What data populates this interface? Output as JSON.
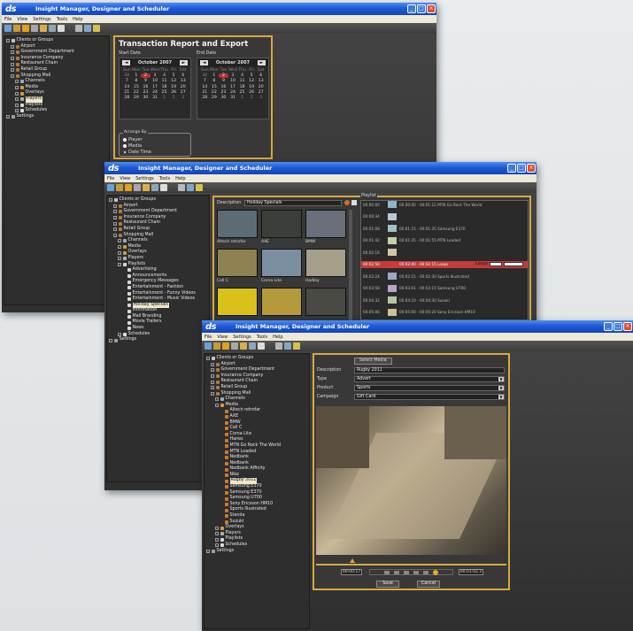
{
  "app_title": "Insight Manager, Designer and Scheduler",
  "logo_text": "ds",
  "menu": [
    "File",
    "View",
    "Settings",
    "Tools",
    "Help"
  ],
  "window_controls": {
    "min": "_",
    "max": "□",
    "close": "×"
  },
  "win1": {
    "tree": [
      {
        "label": "Clients or Groups",
        "indent": 0,
        "icon": "group"
      },
      {
        "label": "Airport",
        "indent": 1,
        "icon": "client"
      },
      {
        "label": "Government Department",
        "indent": 1,
        "icon": "client"
      },
      {
        "label": "Insurance Company",
        "indent": 1,
        "icon": "client"
      },
      {
        "label": "Restaurant Chain",
        "indent": 1,
        "icon": "client"
      },
      {
        "label": "Retail Group",
        "indent": 1,
        "icon": "client"
      },
      {
        "label": "Shopping Mall",
        "indent": 1,
        "icon": "client"
      },
      {
        "label": "Channels",
        "indent": 2,
        "icon": "channel"
      },
      {
        "label": "Media",
        "indent": 2,
        "icon": "media"
      },
      {
        "label": "Overlays",
        "indent": 2,
        "icon": "overlay"
      },
      {
        "label": "Players",
        "indent": 2,
        "icon": "player",
        "selected": true
      },
      {
        "label": "Playlists",
        "indent": 2,
        "icon": "playlist"
      },
      {
        "label": "Schedules",
        "indent": 2,
        "icon": "schedule"
      },
      {
        "label": "Settings",
        "indent": 0,
        "icon": "settings"
      }
    ],
    "panel_title": "Transaction Report and Export",
    "start_label": "Start Date",
    "end_label": "End Date",
    "start_month": "October 2007",
    "end_month": "October 2007",
    "weekdays": [
      "Sun",
      "Mon",
      "Tue",
      "Wed",
      "Thu",
      "Fri",
      "Sat"
    ],
    "start_days": [
      "30",
      "1",
      "2",
      "3",
      "4",
      "5",
      "6",
      "7",
      "8",
      "9",
      "10",
      "11",
      "12",
      "13",
      "14",
      "15",
      "16",
      "17",
      "18",
      "19",
      "20",
      "21",
      "22",
      "23",
      "24",
      "25",
      "26",
      "27",
      "28",
      "29",
      "30",
      "31",
      "1",
      "2",
      "3"
    ],
    "end_days": [
      "30",
      "1",
      "2",
      "3",
      "4",
      "5",
      "6",
      "7",
      "8",
      "9",
      "10",
      "11",
      "12",
      "13",
      "14",
      "15",
      "16",
      "17",
      "18",
      "19",
      "20",
      "21",
      "22",
      "23",
      "24",
      "25",
      "26",
      "27",
      "28",
      "29",
      "30",
      "31",
      "1",
      "2",
      "3"
    ],
    "arrange_label": "Arrange By",
    "arrange_options": [
      "Player",
      "Media",
      "Date Time"
    ]
  },
  "win2": {
    "tree": [
      {
        "label": "Clients or Groups",
        "indent": 0,
        "icon": "group"
      },
      {
        "label": "Airport",
        "indent": 1,
        "icon": "client"
      },
      {
        "label": "Government Department",
        "indent": 1,
        "icon": "client"
      },
      {
        "label": "Insurance Company",
        "indent": 1,
        "icon": "client"
      },
      {
        "label": "Restaurant Chain",
        "indent": 1,
        "icon": "client"
      },
      {
        "label": "Retail Group",
        "indent": 1,
        "icon": "client"
      },
      {
        "label": "Shopping Mall",
        "indent": 1,
        "icon": "client"
      },
      {
        "label": "Channels",
        "indent": 2,
        "icon": "channel"
      },
      {
        "label": "Media",
        "indent": 2,
        "icon": "media"
      },
      {
        "label": "Overlays",
        "indent": 2,
        "icon": "overlay"
      },
      {
        "label": "Players",
        "indent": 2,
        "icon": "player"
      },
      {
        "label": "Playlists",
        "indent": 2,
        "icon": "playlist"
      },
      {
        "label": "Advertising",
        "indent": 3,
        "icon": "playlist"
      },
      {
        "label": "Announcements",
        "indent": 3,
        "icon": "playlist"
      },
      {
        "label": "Emergency Messages",
        "indent": 3,
        "icon": "playlist"
      },
      {
        "label": "Entertainment - Fashion",
        "indent": 3,
        "icon": "playlist"
      },
      {
        "label": "Entertainment - Funny Videos",
        "indent": 3,
        "icon": "playlist"
      },
      {
        "label": "Entertainment - Music Videos",
        "indent": 3,
        "icon": "playlist"
      },
      {
        "label": "Holiday Specials",
        "indent": 3,
        "icon": "playlist",
        "selected": true
      },
      {
        "label": "Information",
        "indent": 3,
        "icon": "playlist"
      },
      {
        "label": "Mall Branding",
        "indent": 3,
        "icon": "playlist"
      },
      {
        "label": "Movie Trailers",
        "indent": 3,
        "icon": "playlist"
      },
      {
        "label": "News",
        "indent": 3,
        "icon": "playlist"
      },
      {
        "label": "Schedules",
        "indent": 2,
        "icon": "schedule"
      },
      {
        "label": "Settings",
        "indent": 0,
        "icon": "settings"
      }
    ],
    "description_label": "Description",
    "description_value": "Holiday Specials",
    "playlist_label": "Playlist",
    "thumbs": [
      {
        "label": "Altech retrofar",
        "color": "#5d6b74"
      },
      {
        "label": "AXE",
        "color": "#3b3f3a"
      },
      {
        "label": "BMW",
        "color": "#6a6f7a"
      },
      {
        "label": "Cell C",
        "color": "#8e8252"
      },
      {
        "label": "Corna Lite",
        "color": "#7b8fa0"
      },
      {
        "label": "Hadley",
        "color": "#a69f8a"
      },
      {
        "label": "",
        "color": "#d8c21a"
      },
      {
        "label": "",
        "color": "#b49a3a"
      },
      {
        "label": "",
        "color": "#4a4a44"
      }
    ],
    "playlist_items": [
      {
        "time": "00:00:00",
        "text": "00:00:00 - 00:01:15  MTN Go Rock The World",
        "color": "#8fb4c8"
      },
      {
        "time": "00:00:34",
        "text": "",
        "color": "#b7c8d6"
      },
      {
        "time": "00:01:08",
        "text": "00:01:15 - 00:01:35  Samsung E370",
        "color": "#9fc1c8"
      },
      {
        "time": "00:01:42",
        "text": "00:01:35 - 00:01:55  MTN Loaded",
        "color": "#c6d0a6"
      },
      {
        "time": "00:02:16",
        "text": "",
        "color": "#d2c7a5"
      },
      {
        "time": "00:02:50",
        "text": "00:02:00 - 00:02:15  Loops",
        "color": "#cc3b3b"
      },
      {
        "time": "00:03:24",
        "text": "00:02:15 - 00:02:30  Sports Illustrated",
        "color": "#9ea7c6"
      },
      {
        "time": "00:03:58",
        "text": "00:03:01 - 00:03:15  Samsung U700",
        "color": "#b9a3c6"
      },
      {
        "time": "00:04:32",
        "text": "00:04:10 - 00:04:30  Suzuki",
        "color": "#b6c6a0"
      },
      {
        "time": "00:05:06",
        "text": "00:05:00 - 00:05:20  Sony Ericsson HM10",
        "color": "#c7c29a"
      }
    ],
    "loops_label": "Loops"
  },
  "win3": {
    "tree": [
      {
        "label": "Clients or Groups",
        "indent": 0,
        "icon": "group"
      },
      {
        "label": "Airport",
        "indent": 1,
        "icon": "client"
      },
      {
        "label": "Government Department",
        "indent": 1,
        "icon": "client"
      },
      {
        "label": "Insurance Company",
        "indent": 1,
        "icon": "client"
      },
      {
        "label": "Restaurant Chain",
        "indent": 1,
        "icon": "client"
      },
      {
        "label": "Retail Group",
        "indent": 1,
        "icon": "client"
      },
      {
        "label": "Shopping Mall",
        "indent": 1,
        "icon": "client"
      },
      {
        "label": "Channels",
        "indent": 2,
        "icon": "channel"
      },
      {
        "label": "Media",
        "indent": 2,
        "icon": "media"
      },
      {
        "label": "Altech retrofar",
        "indent": 3,
        "icon": "mediaitem"
      },
      {
        "label": "AXE",
        "indent": 3,
        "icon": "mediaitem"
      },
      {
        "label": "BMW",
        "indent": 3,
        "icon": "mediaitem"
      },
      {
        "label": "Cell C",
        "indent": 3,
        "icon": "mediaitem"
      },
      {
        "label": "Corna Lite",
        "indent": 3,
        "icon": "mediaitem"
      },
      {
        "label": "Hanes",
        "indent": 3,
        "icon": "mediaitem"
      },
      {
        "label": "MTN Go Rock The World",
        "indent": 3,
        "icon": "mediaitem"
      },
      {
        "label": "MTN Loaded",
        "indent": 3,
        "icon": "mediaitem"
      },
      {
        "label": "Nedbank",
        "indent": 3,
        "icon": "mediaitem"
      },
      {
        "label": "Nedbank",
        "indent": 3,
        "icon": "mediaitem"
      },
      {
        "label": "Nedbank Affinity",
        "indent": 3,
        "icon": "mediaitem"
      },
      {
        "label": "Nike",
        "indent": 3,
        "icon": "mediaitem"
      },
      {
        "label": "Rugby 2011",
        "indent": 3,
        "icon": "mediaitem",
        "selected": true
      },
      {
        "label": "Samsung E370",
        "indent": 3,
        "icon": "mediaitem"
      },
      {
        "label": "Samsung E370",
        "indent": 3,
        "icon": "mediaitem"
      },
      {
        "label": "Samsung U700",
        "indent": 3,
        "icon": "mediaitem"
      },
      {
        "label": "Sony Ericsson HM10",
        "indent": 3,
        "icon": "mediaitem"
      },
      {
        "label": "Sports Illustrated",
        "indent": 3,
        "icon": "mediaitem"
      },
      {
        "label": "Standa",
        "indent": 3,
        "icon": "mediaitem"
      },
      {
        "label": "Suzuki",
        "indent": 3,
        "icon": "mediaitem"
      },
      {
        "label": "Overlays",
        "indent": 2,
        "icon": "overlay"
      },
      {
        "label": "Players",
        "indent": 2,
        "icon": "player"
      },
      {
        "label": "Playlists",
        "indent": 2,
        "icon": "playlist"
      },
      {
        "label": "Schedules",
        "indent": 2,
        "icon": "schedule"
      },
      {
        "label": "Settings",
        "indent": 0,
        "icon": "settings"
      }
    ],
    "select_media_label": "Select Media",
    "fields": [
      {
        "label": "Description",
        "value": "Rugby 2011",
        "dropdown": false
      },
      {
        "label": "Type",
        "value": "Advert",
        "dropdown": true
      },
      {
        "label": "Product",
        "value": "Sports",
        "dropdown": true
      },
      {
        "label": "Campaign",
        "value": "Gift Card",
        "dropdown": true
      }
    ],
    "time_start": "00:00:17",
    "time_end": "00:01:02.2",
    "save_label": "Save",
    "cancel_label": "Cancel"
  },
  "colors": {
    "accent": "#d8a93c",
    "title_blue": "#1d5ad8",
    "selected_red": "#c0302a"
  }
}
